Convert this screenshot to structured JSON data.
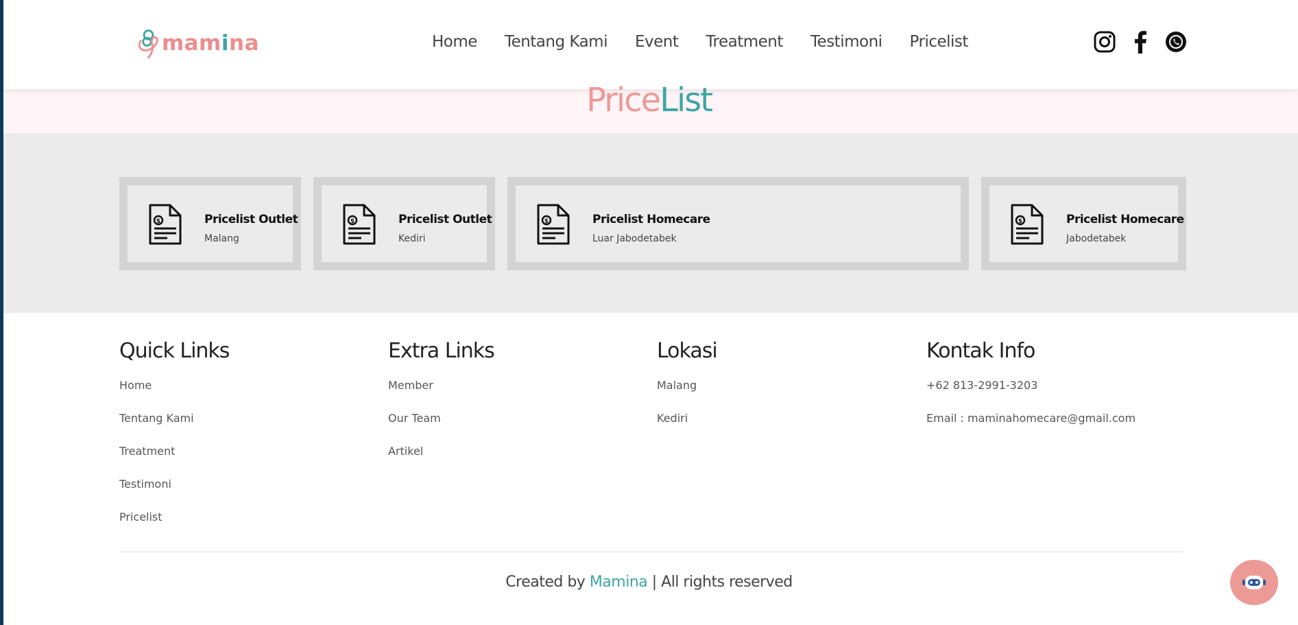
{
  "header": {
    "logo_text": "mamina",
    "nav": [
      "Home",
      "Tentang Kami",
      "Event",
      "Treatment",
      "Testimoni",
      "Pricelist"
    ],
    "social_icons": [
      "instagram-icon",
      "facebook-icon",
      "whatsapp-icon"
    ]
  },
  "page": {
    "title_part1": "Price",
    "title_part2": "List"
  },
  "cards": [
    {
      "title": "Pricelist Outlet",
      "subtitle": "Malang"
    },
    {
      "title": "Pricelist Outlet",
      "subtitle": "Kediri"
    },
    {
      "title": "Pricelist Homecare",
      "subtitle": "Luar Jabodetabek"
    },
    {
      "title": "Pricelist Homecare",
      "subtitle": "Jabodetabek"
    }
  ],
  "footer": {
    "quick_links": {
      "heading": "Quick Links",
      "items": [
        "Home",
        "Tentang Kami",
        "Treatment",
        "Testimoni",
        "Pricelist"
      ]
    },
    "extra_links": {
      "heading": "Extra Links",
      "items": [
        "Member",
        "Our Team",
        "Artikel"
      ]
    },
    "lokasi": {
      "heading": "Lokasi",
      "items": [
        "Malang",
        "Kediri"
      ]
    },
    "kontak": {
      "heading": "Kontak Info",
      "items": [
        "+62 813-2991-3203",
        "Email : maminahomecare@gmail.com"
      ]
    },
    "copyright_prefix": "Created by ",
    "copyright_brand": "Mamina",
    "copyright_suffix": " | All rights reserved"
  },
  "colors": {
    "brand_pink": "#ec9a96",
    "brand_teal": "#3ea6a2",
    "card_border": "#d3d3d3",
    "section_bg": "#ebebeb"
  }
}
